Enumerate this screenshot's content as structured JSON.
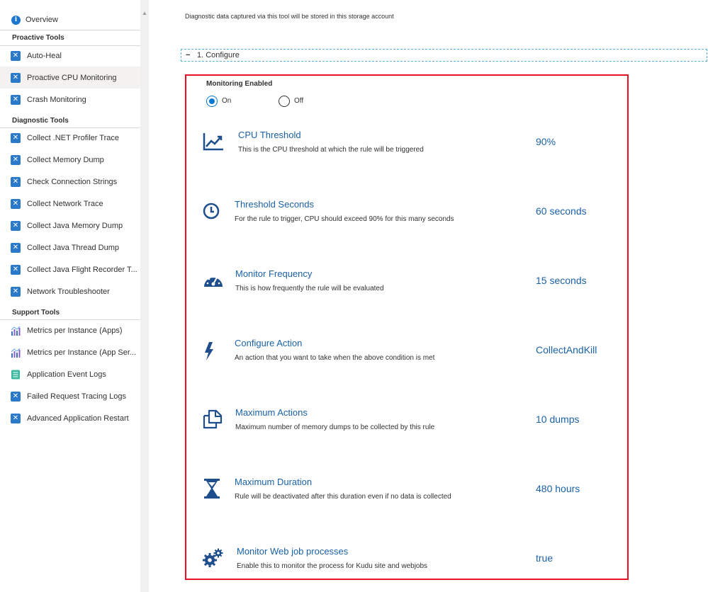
{
  "sidebar": {
    "overview": {
      "label": "Overview",
      "icon": "info-icon"
    },
    "sections": [
      {
        "title": "Proactive Tools",
        "items": [
          {
            "label": "Auto-Heal",
            "icon": "tool-icon"
          },
          {
            "label": "Proactive CPU Monitoring",
            "icon": "tool-icon",
            "selected": true
          },
          {
            "label": "Crash Monitoring",
            "icon": "tool-icon"
          }
        ]
      },
      {
        "title": "Diagnostic Tools",
        "items": [
          {
            "label": "Collect .NET Profiler Trace",
            "icon": "tool-icon"
          },
          {
            "label": "Collect Memory Dump",
            "icon": "tool-icon"
          },
          {
            "label": "Check Connection Strings",
            "icon": "tool-icon"
          },
          {
            "label": "Collect Network Trace",
            "icon": "tool-icon"
          },
          {
            "label": "Collect Java Memory Dump",
            "icon": "tool-icon"
          },
          {
            "label": "Collect Java Thread Dump",
            "icon": "tool-icon"
          },
          {
            "label": "Collect Java Flight Recorder T...",
            "icon": "tool-icon"
          },
          {
            "label": "Network Troubleshooter",
            "icon": "tool-icon"
          }
        ]
      },
      {
        "title": "Support Tools",
        "items": [
          {
            "label": "Metrics per Instance (Apps)",
            "icon": "metrics-icon"
          },
          {
            "label": "Metrics per Instance (App Ser...",
            "icon": "metrics-icon"
          },
          {
            "label": "Application Event Logs",
            "icon": "event-log-icon"
          },
          {
            "label": "Failed Request Tracing Logs",
            "icon": "tool-icon"
          },
          {
            "label": "Advanced Application Restart",
            "icon": "tool-icon"
          }
        ]
      }
    ]
  },
  "main": {
    "top_description": "Diagnostic data captured via this tool will be stored in this storage account",
    "configure_section": {
      "toggle": "−",
      "title": "1. Configure"
    },
    "monitoring": {
      "label": "Monitoring Enabled",
      "options": [
        {
          "label": "On",
          "checked": true
        },
        {
          "label": "Off",
          "checked": false
        }
      ]
    },
    "settings": [
      {
        "icon": "trend-chart-icon",
        "title": "CPU Threshold",
        "description": "This is the CPU threshold at which the rule will be triggered",
        "value": "90%"
      },
      {
        "icon": "clock-icon",
        "title": "Threshold Seconds",
        "description": "For the rule to trigger, CPU should exceed 90% for this many seconds",
        "value": "60 seconds"
      },
      {
        "icon": "gauge-icon",
        "title": "Monitor Frequency",
        "description": "This is how frequently the rule will be evaluated",
        "value": "15 seconds"
      },
      {
        "icon": "lightning-icon",
        "title": "Configure Action",
        "description": "An action that you want to take when the above condition is met",
        "value": "CollectAndKill"
      },
      {
        "icon": "copy-icon",
        "title": "Maximum Actions",
        "description": "Maximum number of memory dumps to be collected by this rule",
        "value": "10 dumps"
      },
      {
        "icon": "hourglass-icon",
        "title": "Maximum Duration",
        "description": "Rule will be deactivated after this duration even if no data is collected",
        "value": "480 hours"
      },
      {
        "icon": "gears-icon",
        "title": "Monitor Web job processes",
        "description": "Enable this to monitor the process for Kudu site and webjobs",
        "value": "true"
      }
    ]
  },
  "colors": {
    "accent": "#0078d4",
    "title_blue": "#1a61a8",
    "highlight_red": "#e81123",
    "icon_navy": "#1f4e8c"
  }
}
